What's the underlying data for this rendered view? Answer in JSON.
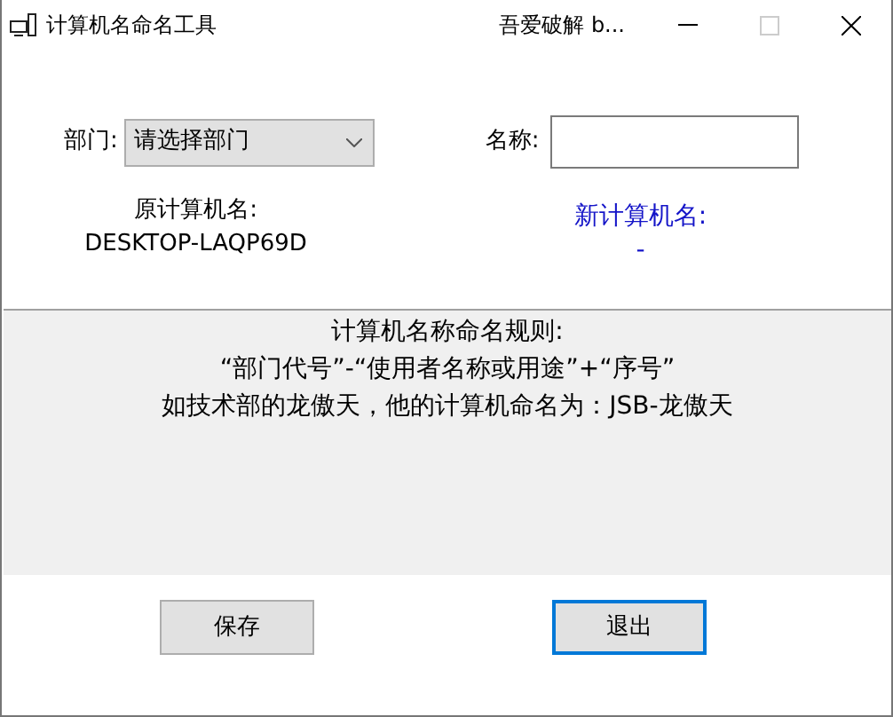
{
  "window": {
    "title": "计算机名命名工具",
    "caption_text": "吾爱破解 b..."
  },
  "department": {
    "label": "部门:",
    "value": "请选择部门"
  },
  "name_field": {
    "label": "名称:"
  },
  "original_name": {
    "label": "原计算机名:",
    "value": "DESKTOP-LAQP69D"
  },
  "new_name": {
    "label": "新计算机名:",
    "value": "-"
  },
  "rules": [
    "计算机名称命名规则:",
    "“部门代号”-“使用者名称或用途”+“序号”",
    "如技术部的龙傲天，他的计算机命名为：JSB-龙傲天"
  ],
  "buttons": [
    {
      "label": "保存",
      "focused": false
    },
    {
      "label": "退出",
      "focused": true
    }
  ]
}
